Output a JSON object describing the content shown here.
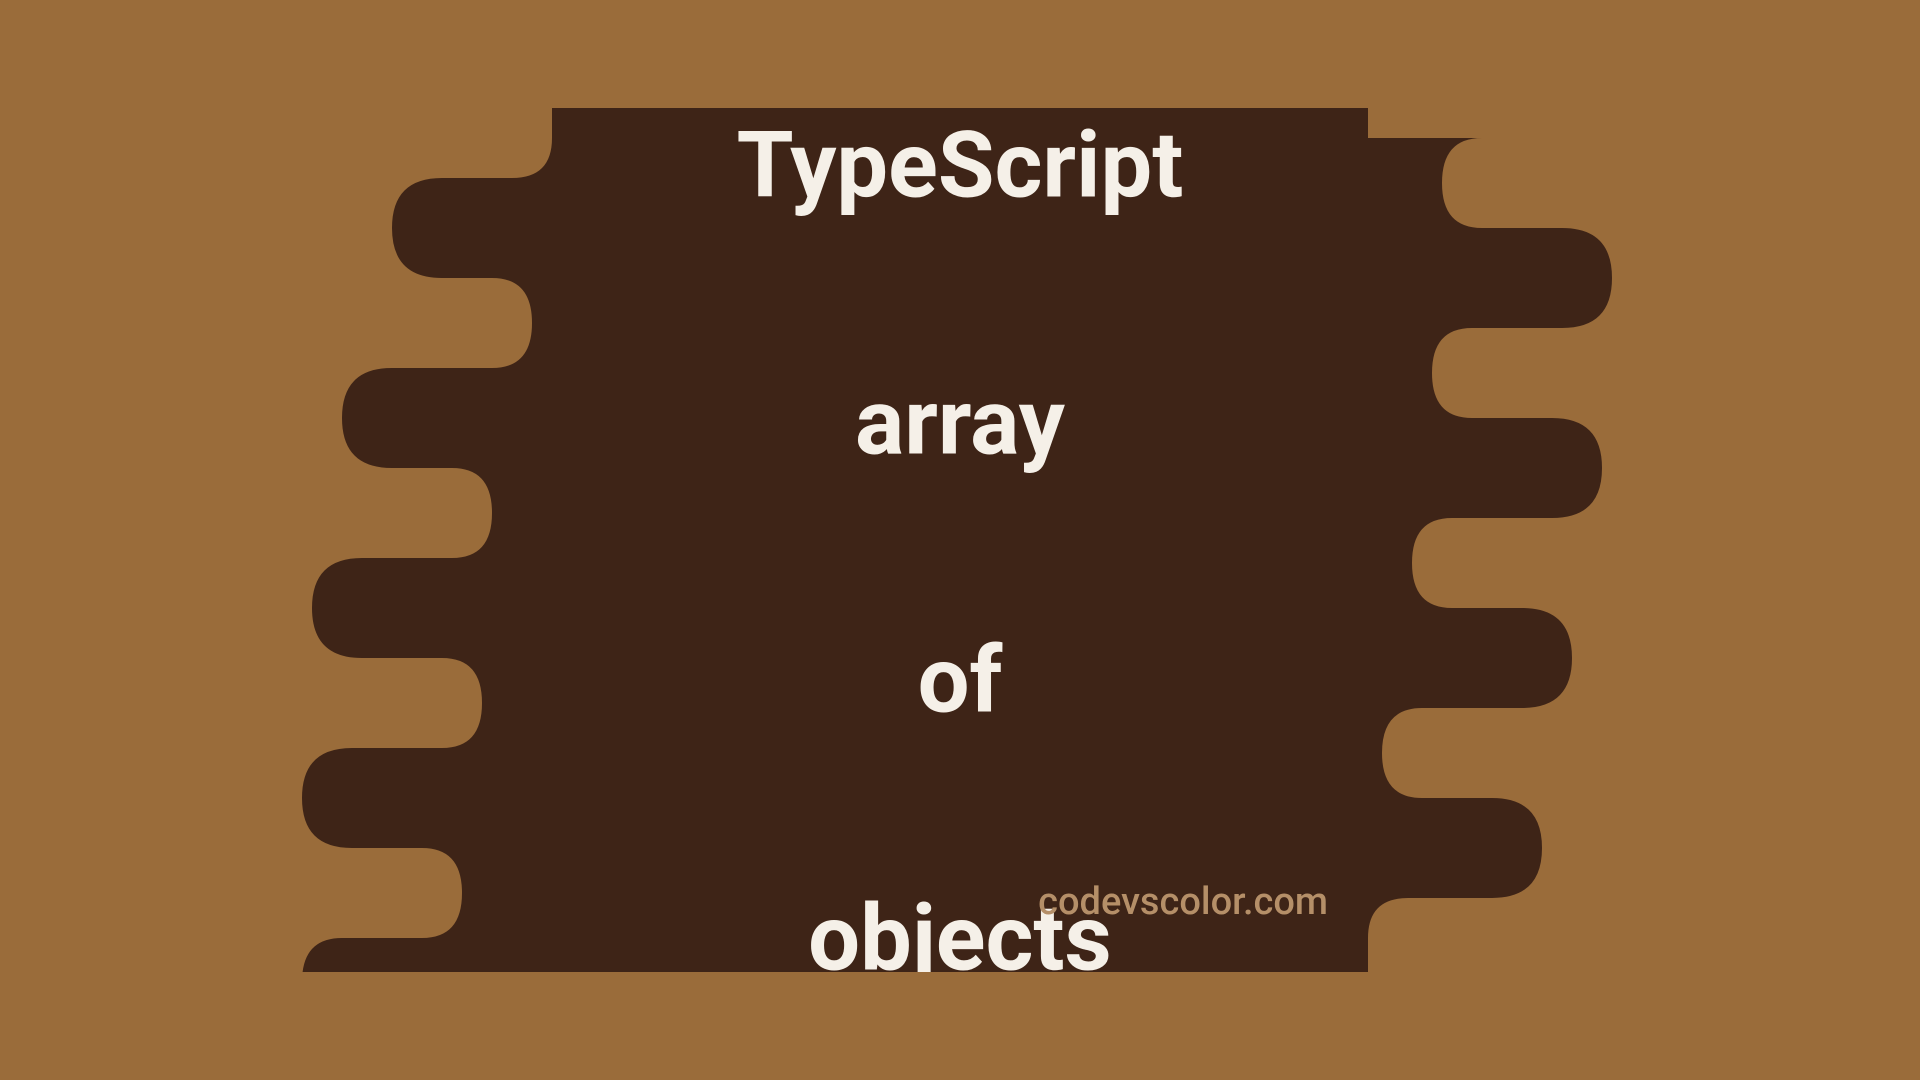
{
  "title": {
    "line1": "TypeScript",
    "line2": "array",
    "line3": "of",
    "line4": "objects"
  },
  "footer": "codevscolor.com",
  "colors": {
    "background_light": "#9a6c3a",
    "background_dark": "#3e2417",
    "text_primary": "#f5f0e8",
    "text_secondary": "#b58f68"
  }
}
